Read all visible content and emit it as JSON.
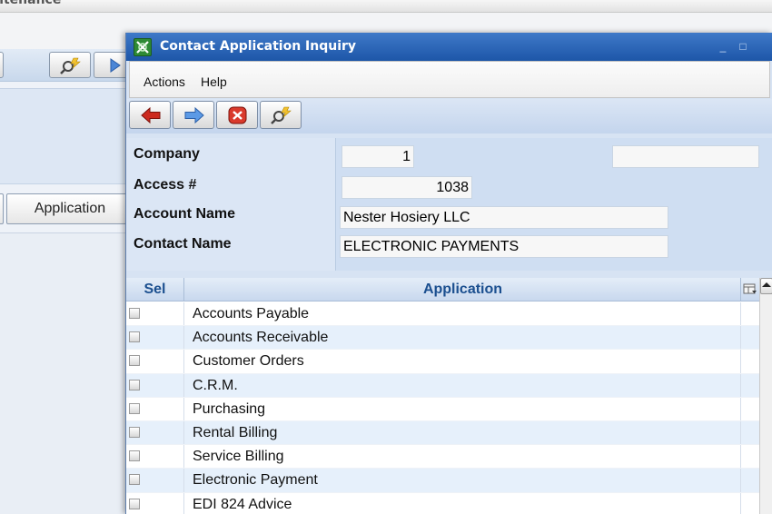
{
  "background_app": {
    "title_fragment": "ntenance",
    "tab_label": "Application"
  },
  "dialog": {
    "title": "Contact Application Inquiry",
    "window_controls": {
      "minimize": "_",
      "maximize": "□"
    },
    "menu": [
      {
        "label": "Actions"
      },
      {
        "label": "Help"
      }
    ],
    "toolbar": [
      {
        "icon": "back-arrow-icon"
      },
      {
        "icon": "forward-arrow-icon"
      },
      {
        "icon": "cancel-icon"
      },
      {
        "icon": "search-icon"
      }
    ]
  },
  "form": {
    "company_label": "Company",
    "company_value": "1",
    "company_name_value": "",
    "access_label": "Access #",
    "access_value": "1038",
    "account_label": "Account Name",
    "account_value": "Nester Hosiery LLC",
    "contact_label": "Contact Name",
    "contact_value": "ELECTRONIC PAYMENTS"
  },
  "grid": {
    "columns": {
      "sel": "Sel",
      "application": "Application"
    },
    "rows": [
      {
        "selected": false,
        "application": "Accounts Payable"
      },
      {
        "selected": false,
        "application": "Accounts Receivable"
      },
      {
        "selected": false,
        "application": "Customer Orders"
      },
      {
        "selected": false,
        "application": "C.R.M."
      },
      {
        "selected": false,
        "application": "Purchasing"
      },
      {
        "selected": false,
        "application": "Rental Billing"
      },
      {
        "selected": false,
        "application": "Service Billing"
      },
      {
        "selected": false,
        "application": "Electronic Payment"
      },
      {
        "selected": false,
        "application": "EDI 824 Advice"
      }
    ]
  },
  "colors": {
    "titlebar": "#1d56a8",
    "header_text": "#1b4f8f",
    "alt_row": "#e6f0fb"
  }
}
